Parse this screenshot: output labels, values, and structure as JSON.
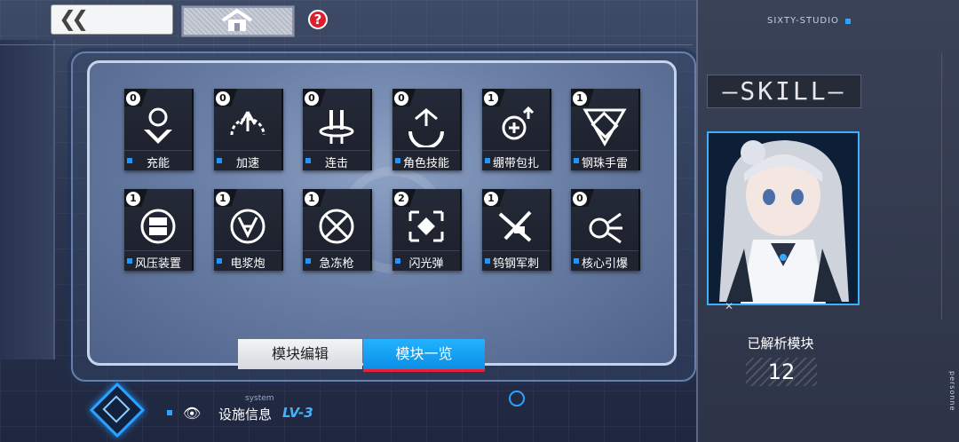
{
  "nav": {
    "back_icon": "double-chevron-left-icon",
    "home_icon": "home-icon",
    "help_label": "?"
  },
  "modules": [
    {
      "label": "充能",
      "count": "0",
      "icon": "charge-icon"
    },
    {
      "label": "加速",
      "count": "0",
      "icon": "speed-icon"
    },
    {
      "label": "连击",
      "count": "0",
      "icon": "combo-icon"
    },
    {
      "label": "角色技能",
      "count": "0",
      "icon": "character-skill-icon"
    },
    {
      "label": "绷带包扎",
      "count": "1",
      "icon": "bandage-icon"
    },
    {
      "label": "钢珠手雷",
      "count": "1",
      "icon": "grenade-icon"
    },
    {
      "label": "风压装置",
      "count": "1",
      "icon": "wind-device-icon"
    },
    {
      "label": "电浆炮",
      "count": "1",
      "icon": "plasma-cannon-icon"
    },
    {
      "label": "急冻枪",
      "count": "1",
      "icon": "freeze-gun-icon"
    },
    {
      "label": "闪光弹",
      "count": "2",
      "icon": "flashbang-icon"
    },
    {
      "label": "钨钢军刺",
      "count": "1",
      "icon": "bayonet-icon"
    },
    {
      "label": "核心引爆",
      "count": "0",
      "icon": "core-detonate-icon"
    }
  ],
  "tabs": {
    "edit": "模块编辑",
    "list": "模块一览",
    "active": "list"
  },
  "system": {
    "small": "system",
    "label": "设施信息",
    "level": "LV-3"
  },
  "right": {
    "studio": "SIXTY-STUDIO",
    "title": "—SKILL—",
    "analyzed_label": "已解析模块",
    "analyzed_count": "12",
    "vertical_text": "personne"
  },
  "colors": {
    "accent": "#1e96ff",
    "active_tab": "#0b8ee5",
    "help": "#e11c2d"
  }
}
